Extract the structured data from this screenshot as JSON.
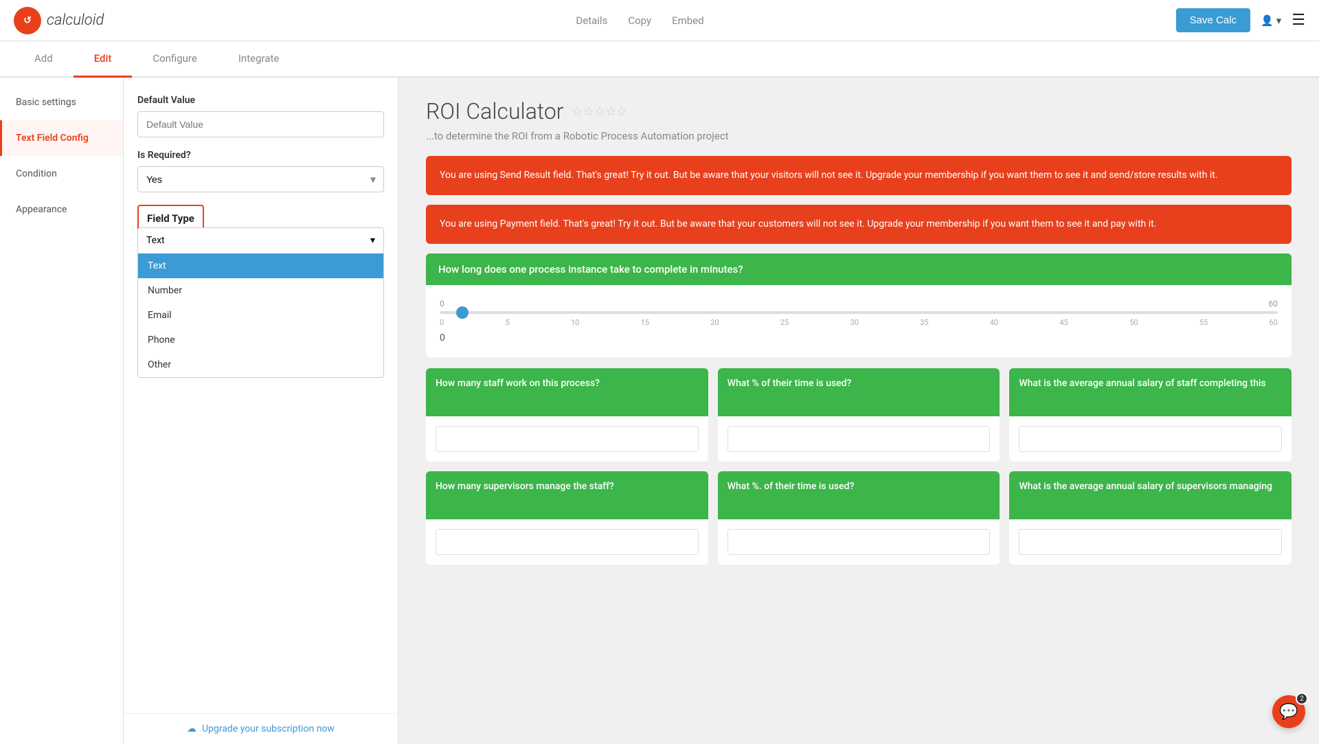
{
  "header": {
    "logo_text": "calculoid",
    "nav": {
      "details": "Details",
      "copy": "Copy",
      "embed": "Embed"
    },
    "save_button": "Save Calc",
    "hamburger": "☰"
  },
  "tabs": [
    {
      "id": "add",
      "label": "Add"
    },
    {
      "id": "edit",
      "label": "Edit",
      "active": true
    },
    {
      "id": "configure",
      "label": "Configure"
    },
    {
      "id": "integrate",
      "label": "Integrate"
    }
  ],
  "sidebar": {
    "items": [
      {
        "id": "basic-settings",
        "label": "Basic settings"
      },
      {
        "id": "text-field-config",
        "label": "Text Field Config",
        "active": true
      },
      {
        "id": "condition",
        "label": "Condition"
      },
      {
        "id": "appearance",
        "label": "Appearance"
      }
    ]
  },
  "config_panel": {
    "default_value_label": "Default Value",
    "default_value_placeholder": "Default Value",
    "is_required_label": "Is Required?",
    "is_required_value": "Yes",
    "field_type_label": "Field Type",
    "field_type_selected": "Text",
    "dropdown_options": [
      {
        "id": "text",
        "label": "Text",
        "selected": true
      },
      {
        "id": "number",
        "label": "Number"
      },
      {
        "id": "email",
        "label": "Email"
      },
      {
        "id": "phone",
        "label": "Phone"
      },
      {
        "id": "other",
        "label": "Other"
      }
    ],
    "upgrade_text": "Upgrade your subscription now"
  },
  "preview": {
    "title": "ROI Calculator",
    "stars": "★★★★★",
    "subtitle": "...to determine the ROI from a Robotic Process Automation project",
    "alert1": "You are using Send Result field. That's great! Try it out. But be aware that your visitors will not see it. Upgrade your membership if you want them to see it and send/store results with it.",
    "alert2": "You are using Payment field. That's great! Try it out. But be aware that your customers will not see it. Upgrade your membership if you want them to see it and pay with it.",
    "slider_question": "How long does one process instance take to complete in minutes?",
    "slider_min": "0",
    "slider_max": "60",
    "slider_ticks": [
      "0",
      "5",
      "10",
      "15",
      "20",
      "25",
      "30",
      "35",
      "40",
      "45",
      "50",
      "55",
      "60"
    ],
    "slider_value": "0",
    "cards": [
      {
        "question": "How many staff work on this process?",
        "input_placeholder": ""
      },
      {
        "question": "What % of their time is used?",
        "input_placeholder": ""
      },
      {
        "question": "What is the average annual salary of staff completing this",
        "input_placeholder": ""
      }
    ],
    "cards2": [
      {
        "question": "How many supervisors manage the staff?",
        "input_placeholder": ""
      },
      {
        "question": "What %. of their time is used?",
        "input_placeholder": ""
      },
      {
        "question": "What is the average annual salary of supervisors managing",
        "input_placeholder": ""
      }
    ]
  },
  "chat_badge": "2"
}
